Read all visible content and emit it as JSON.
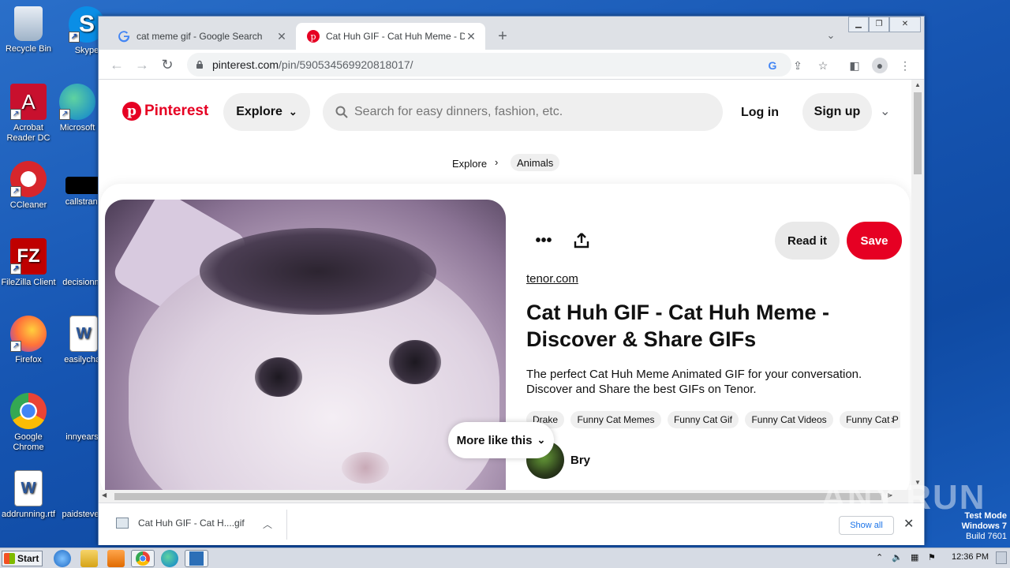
{
  "desktop": {
    "icons": [
      {
        "label": "Recycle Bin"
      },
      {
        "label": "Skype"
      },
      {
        "label": "Acrobat Reader DC"
      },
      {
        "label": "Microsoft"
      },
      {
        "label": "CCleaner"
      },
      {
        "label": "callstrans"
      },
      {
        "label": "FileZilla Client"
      },
      {
        "label": "decisionm"
      },
      {
        "label": "Firefox"
      },
      {
        "label": "easilychar"
      },
      {
        "label": "Google Chrome"
      },
      {
        "label": "innyears"
      },
      {
        "label": "addrunning.rtf"
      },
      {
        "label": "paidsteve"
      }
    ]
  },
  "browser": {
    "tabs": [
      {
        "title": "cat meme gif - Google Search",
        "icon": "google-icon"
      },
      {
        "title": "Cat Huh GIF - Cat Huh Meme - Disco",
        "icon": "pinterest-icon"
      }
    ],
    "url_domain": "pinterest.com",
    "url_path": "/pin/590534569920818017/",
    "new_tab": "+",
    "colors": {
      "tabstrip": "#dee1e6",
      "omnibox": "#f1f3f4"
    }
  },
  "pinterest": {
    "logo_text": "Pinterest",
    "explore_label": "Explore",
    "search_placeholder": "Search for easy dinners, fashion, etc.",
    "login_label": "Log in",
    "signup_label": "Sign up",
    "breadcrumb": {
      "root": "Explore",
      "current": "Animals"
    },
    "pin": {
      "read_label": "Read it",
      "save_label": "Save",
      "source": "tenor.com",
      "title": "Cat Huh GIF - Cat Huh Meme - Discover & Share GIFs",
      "description": "The perfect Cat Huh Meme Animated GIF for your conversation. Discover and Share the best GIFs on Tenor.",
      "tags": [
        "Drake",
        "Funny Cat Memes",
        "Funny Cat Gif",
        "Funny Cat Videos",
        "Funny Cat P"
      ],
      "user": "Bry",
      "more_like_this": "More like this"
    },
    "colors": {
      "brand": "#e60023",
      "pill": "#efefef"
    }
  },
  "downloads": {
    "file": "Cat Huh GIF - Cat H....gif",
    "show_all": "Show all"
  },
  "taskbar": {
    "start": "Start",
    "clock": "12:36 PM"
  },
  "overlay": {
    "watermark": "ANY.RUN",
    "test_mode": "Test Mode",
    "os": "Windows 7",
    "build": "Build 7601"
  }
}
